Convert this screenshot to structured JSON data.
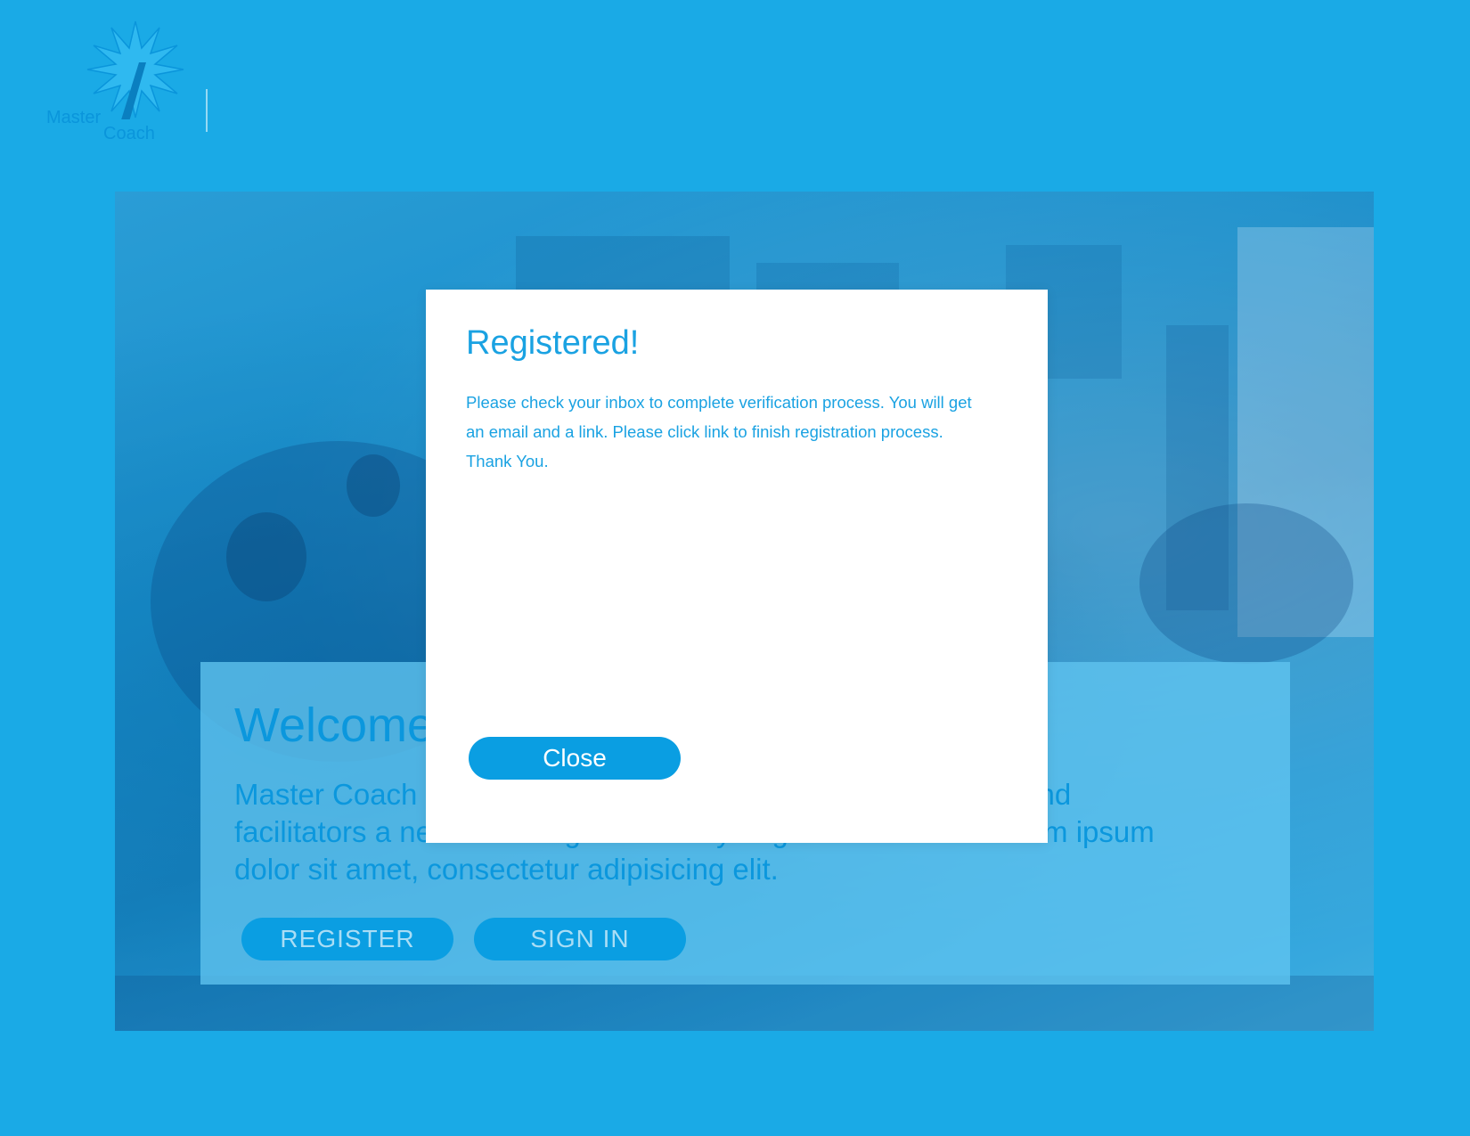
{
  "header": {
    "logo": {
      "icon": "starburst-icon",
      "line1": "Master",
      "line2": "Coach"
    }
  },
  "hero": {
    "title": "Welcome.",
    "text": "Master Coach helps teachers and facilitators give educators and facilitators a new and enlightened way to give instruction. Lorem ipsum dolor sit amet, consectetur adipisicing elit.",
    "register_label": "REGISTER",
    "signin_label": "SIGN IN"
  },
  "modal": {
    "title": "Registered!",
    "body": "Please check your inbox to complete verification process. You will get an email and a link. Please click link to finish registration process. Thank You.",
    "close_label": "Close"
  },
  "colors": {
    "background": "#1aaae6",
    "accent": "#0a9ee2",
    "modal_text": "#1aa2e2",
    "modal_bg": "#ffffff"
  }
}
